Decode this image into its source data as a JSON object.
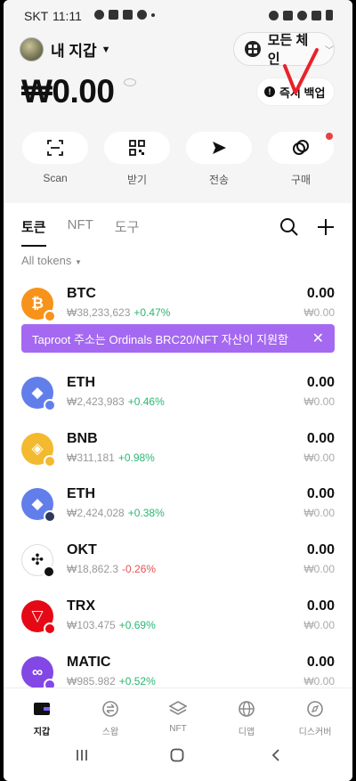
{
  "status_bar": {
    "carrier": "SKT",
    "time": "11:11"
  },
  "header": {
    "wallet_name": "내 지갑",
    "chain_selector": "모든 체인",
    "balance": "₩0.00",
    "backup_label": "즉시 백업"
  },
  "actions": [
    {
      "label": "Scan",
      "icon": "scan-icon"
    },
    {
      "label": "받기",
      "icon": "qr-code-icon"
    },
    {
      "label": "전송",
      "icon": "send-icon"
    },
    {
      "label": "구매",
      "icon": "buy-icon"
    }
  ],
  "tabs": [
    "토큰",
    "NFT",
    "도구"
  ],
  "filter_label": "All tokens",
  "banner": {
    "text": "Taproot 주소는 Ordinals BRC20/NFT 자산이 지원함"
  },
  "tokens": [
    {
      "symbol": "BTC",
      "price": "₩38,233,623",
      "change": "+0.47%",
      "amount": "0.00",
      "value": "₩0.00",
      "color": "#f7931a",
      "glyph": "₿",
      "badge": "#f7931a"
    },
    {
      "symbol": "ETH",
      "price": "₩2,423,983",
      "change": "+0.46%",
      "amount": "0.00",
      "value": "₩0.00",
      "color": "#627eea",
      "glyph": "◆",
      "badge": "#627eea"
    },
    {
      "symbol": "BNB",
      "price": "₩311,181",
      "change": "+0.98%",
      "amount": "0.00",
      "value": "₩0.00",
      "color": "#f3ba2f",
      "glyph": "◈",
      "badge": "#f3ba2f"
    },
    {
      "symbol": "ETH",
      "price": "₩2,424,028",
      "change": "+0.38%",
      "amount": "0.00",
      "value": "₩0.00",
      "color": "#627eea",
      "glyph": "◆",
      "badge": "#2d3a5e"
    },
    {
      "symbol": "OKT",
      "price": "₩18,862.3",
      "change": "-0.26%",
      "amount": "0.00",
      "value": "₩0.00",
      "color": "#ffffff",
      "glyph": "✣",
      "badge": "#111111"
    },
    {
      "symbol": "TRX",
      "price": "₩103.475",
      "change": "+0.69%",
      "amount": "0.00",
      "value": "₩0.00",
      "color": "#e50915",
      "glyph": "▽",
      "badge": "#e50915"
    },
    {
      "symbol": "MATIC",
      "price": "₩985.982",
      "change": "+0.52%",
      "amount": "0.00",
      "value": "₩0.00",
      "color": "#8247e5",
      "glyph": "∞",
      "badge": "#8247e5"
    }
  ],
  "bottom_nav": [
    {
      "label": "지갑",
      "icon": "wallet-icon",
      "active": true
    },
    {
      "label": "스왑",
      "icon": "swap-icon",
      "active": false
    },
    {
      "label": "NFT",
      "icon": "nft-layers-icon",
      "active": false
    },
    {
      "label": "디앱",
      "icon": "globe-icon",
      "active": false
    },
    {
      "label": "디스커버",
      "icon": "compass-icon",
      "active": false
    }
  ],
  "colors": {
    "accent_purple": "#a469f0",
    "positive": "#2bb673",
    "negative": "#e05555",
    "notification_dot": "#e84142"
  }
}
